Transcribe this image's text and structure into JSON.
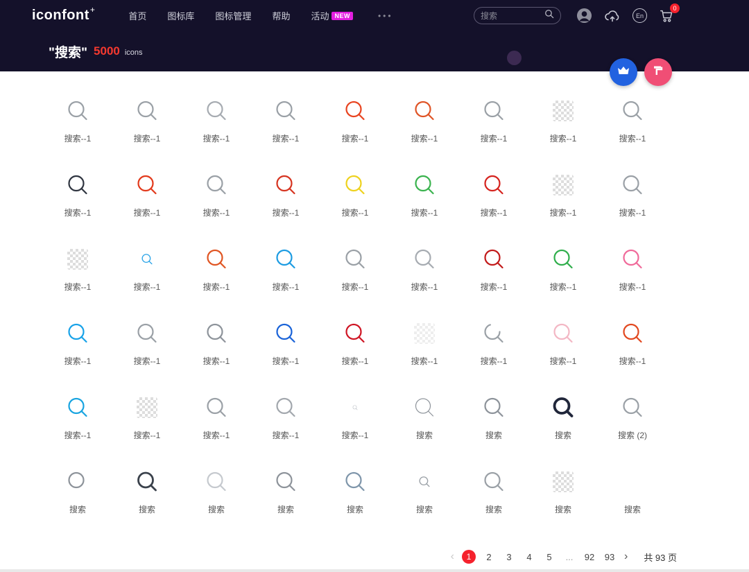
{
  "topbar": {
    "logo": "iconfont",
    "logo_plus": "+",
    "nav": [
      "首页",
      "图标库",
      "图标管理",
      "帮助",
      "活动"
    ],
    "new_badge": "NEW",
    "more_icon": "•••",
    "search_placeholder": "搜索",
    "lang": "En",
    "cart_count": "0"
  },
  "hero": {
    "query": "\"搜索\"",
    "count": "5000",
    "icons_label": "icons"
  },
  "colors": {
    "accent_red": "#f5222d",
    "badge_magenta": "#e31ee0",
    "fab_blue": "#2262e0",
    "fab_pink": "#f04e75",
    "header_bg": "#14112a"
  },
  "grid": {
    "items": [
      {
        "label": "搜索--1",
        "v": "normal",
        "c": "#9aa0a6"
      },
      {
        "label": "搜索--1",
        "v": "normal",
        "c": "#9aa0a6"
      },
      {
        "label": "搜索--1",
        "v": "normal",
        "c": "#a6abb1"
      },
      {
        "label": "搜索--1",
        "v": "normal",
        "c": "#9aa0a6"
      },
      {
        "label": "搜索--1",
        "v": "normal",
        "c": "#e8431f"
      },
      {
        "label": "搜索--1",
        "v": "normal",
        "c": "#df5426"
      },
      {
        "label": "搜索--1",
        "v": "normal",
        "c": "#9aa0a6"
      },
      {
        "label": "搜索--1",
        "v": "checker",
        "c": ""
      },
      {
        "label": "搜索--1",
        "v": "normal",
        "c": "#9aa0a6"
      },
      {
        "label": "搜索--1",
        "v": "normal",
        "c": "#2f3540"
      },
      {
        "label": "搜索--1",
        "v": "normal",
        "c": "#e23a1c"
      },
      {
        "label": "搜索--1",
        "v": "normal",
        "c": "#9aa0a6"
      },
      {
        "label": "搜索--1",
        "v": "normal",
        "c": "#d63420"
      },
      {
        "label": "搜索--1",
        "v": "normal",
        "c": "#eed21e"
      },
      {
        "label": "搜索--1",
        "v": "normal",
        "c": "#3ab34e"
      },
      {
        "label": "搜索--1",
        "v": "normal",
        "c": "#d5231e"
      },
      {
        "label": "搜索--1",
        "v": "checker",
        "c": ""
      },
      {
        "label": "搜索--1",
        "v": "normal",
        "c": "#9aa0a6"
      },
      {
        "label": "搜索--1",
        "v": "checker",
        "c": ""
      },
      {
        "label": "搜索--1",
        "v": "small",
        "c": "#2da5e8"
      },
      {
        "label": "搜索--1",
        "v": "normal",
        "c": "#e05522"
      },
      {
        "label": "搜索--1",
        "v": "normal",
        "c": "#1d9ce2"
      },
      {
        "label": "搜索--1",
        "v": "normal",
        "c": "#9aa0a6"
      },
      {
        "label": "搜索--1",
        "v": "normal",
        "c": "#a6abb1"
      },
      {
        "label": "搜索--1",
        "v": "normal",
        "c": "#c21a1a"
      },
      {
        "label": "搜索--1",
        "v": "normal",
        "c": "#30ae4c"
      },
      {
        "label": "搜索--1",
        "v": "normal",
        "c": "#f06a9a"
      },
      {
        "label": "搜索--1",
        "v": "normal",
        "c": "#18a2e8"
      },
      {
        "label": "搜索--1",
        "v": "normal",
        "c": "#9aa0a6"
      },
      {
        "label": "搜索--1",
        "v": "normal",
        "c": "#8d939a"
      },
      {
        "label": "搜索--1",
        "v": "normal",
        "c": "#1a63d8"
      },
      {
        "label": "搜索--1",
        "v": "normal",
        "c": "#cf1524"
      },
      {
        "label": "搜索--1",
        "v": "checker-light",
        "c": ""
      },
      {
        "label": "搜索--1",
        "v": "partial",
        "c": "#9aa0a6"
      },
      {
        "label": "搜索--1",
        "v": "normal",
        "c": "#f3b7c4"
      },
      {
        "label": "搜索--1",
        "v": "normal",
        "c": "#e2481f"
      },
      {
        "label": "搜索--1",
        "v": "normal",
        "c": "#18a4e0"
      },
      {
        "label": "搜索--1",
        "v": "checker",
        "c": ""
      },
      {
        "label": "搜索--1",
        "v": "normal",
        "c": "#9aa0a6"
      },
      {
        "label": "搜索--1",
        "v": "normal",
        "c": "#a2a7ad"
      },
      {
        "label": "搜索--1",
        "v": "tiny",
        "c": "#b9bec4"
      },
      {
        "label": "搜索",
        "v": "thin",
        "c": "#8d939a"
      },
      {
        "label": "搜索",
        "v": "normal",
        "c": "#8d939a"
      },
      {
        "label": "搜索",
        "v": "bold",
        "c": "#20263a"
      },
      {
        "label": "搜索 (2)",
        "v": "normal",
        "c": "#9aa0a6"
      },
      {
        "label": "搜索",
        "v": "circle",
        "c": "#8d939a"
      },
      {
        "label": "搜索",
        "v": "bold2",
        "c": "#3a414b"
      },
      {
        "label": "搜索",
        "v": "normal",
        "c": "#c5c9ce"
      },
      {
        "label": "搜索",
        "v": "normal",
        "c": "#8d939a"
      },
      {
        "label": "搜索",
        "v": "normal",
        "c": "#7e95aa"
      },
      {
        "label": "搜索",
        "v": "small",
        "c": "#9aa0a6"
      },
      {
        "label": "搜索",
        "v": "normal",
        "c": "#9aa0a6"
      },
      {
        "label": "搜索",
        "v": "checker",
        "c": ""
      },
      {
        "label": "搜索",
        "v": "none",
        "c": ""
      }
    ]
  },
  "pagination": {
    "prev": "‹",
    "next": "›",
    "pages": [
      "1",
      "2",
      "3",
      "4",
      "5",
      "...",
      "92",
      "93"
    ],
    "active_page": "1",
    "total": "共 93 页"
  }
}
